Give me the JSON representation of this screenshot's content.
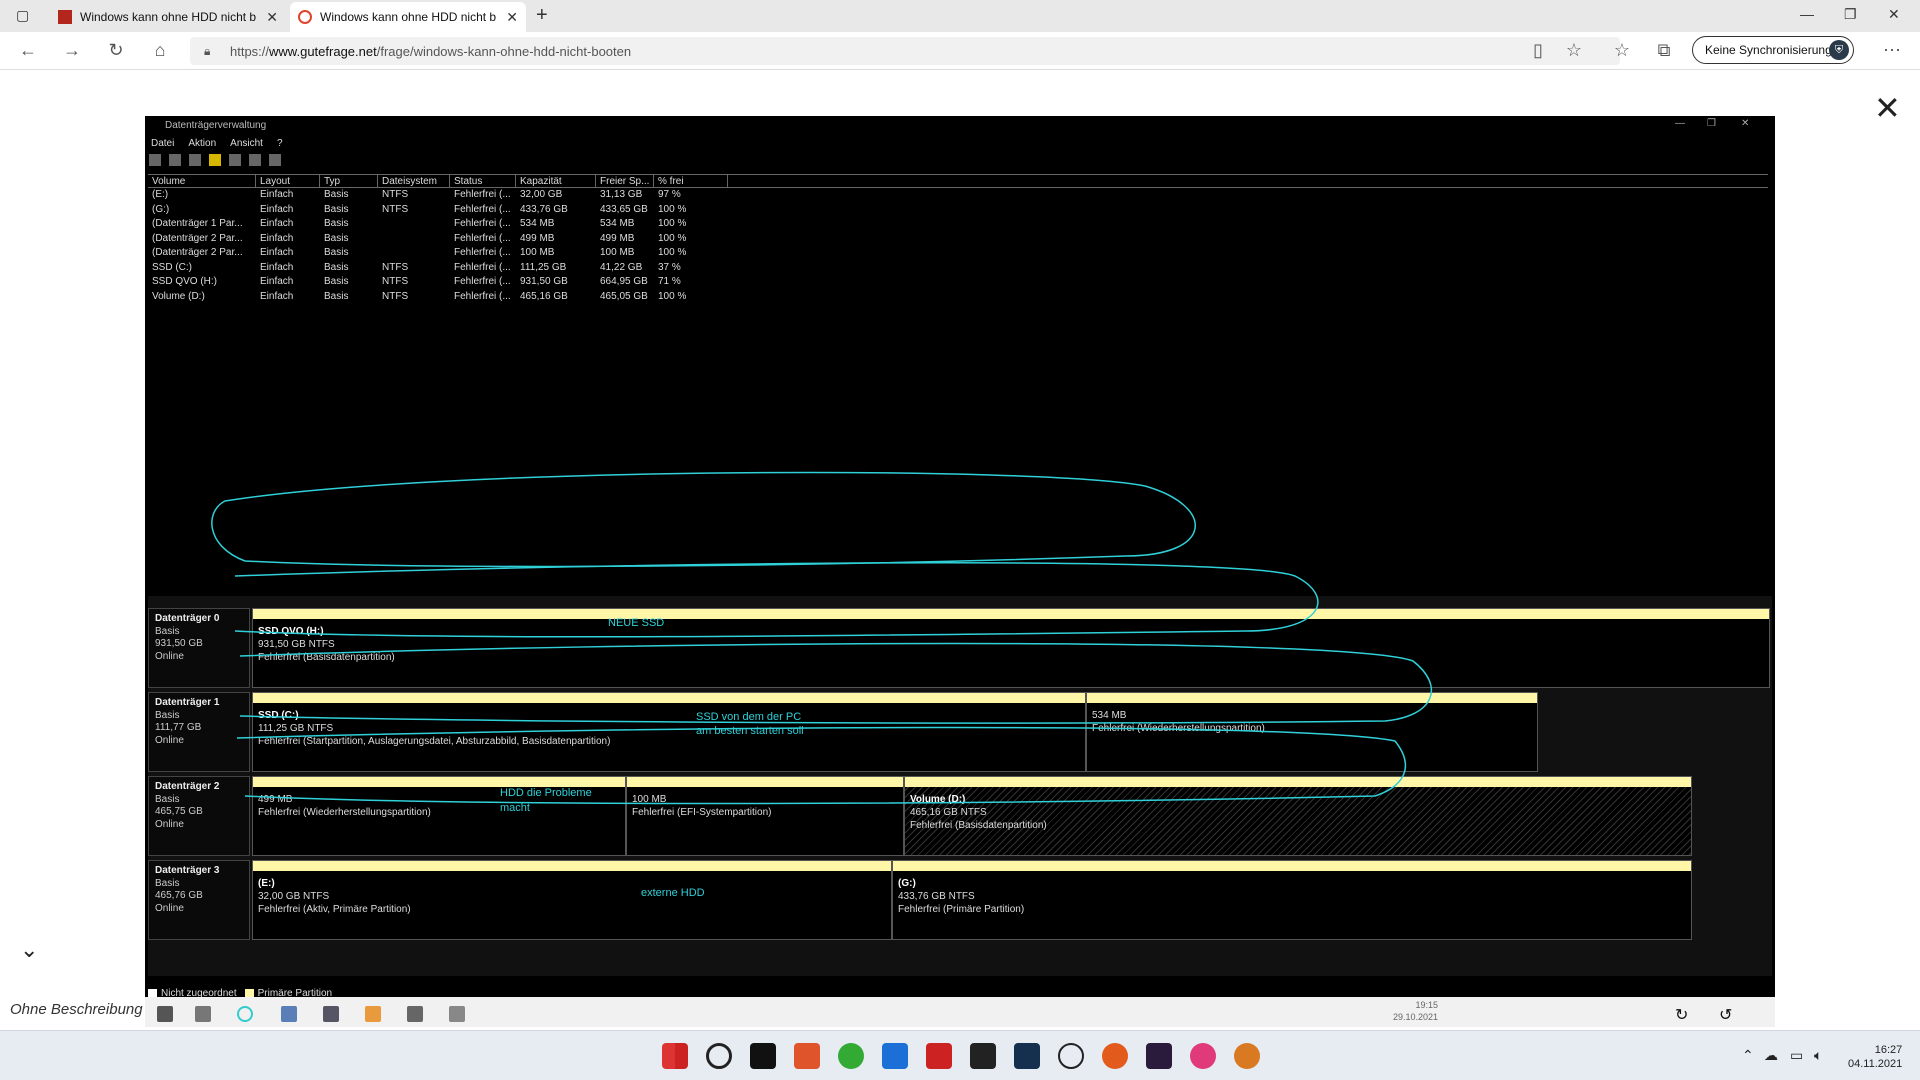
{
  "browser": {
    "tabs": [
      {
        "title": "Windows kann ohne HDD nicht b"
      },
      {
        "title": "Windows kann ohne HDD nicht b"
      }
    ],
    "url_scheme": "https://",
    "url_host": "www.gutefrage.net",
    "url_path": "/frage/windows-kann-ohne-hdd-nicht-booten",
    "sync_label": "Keine Synchronisierung"
  },
  "viewer": {
    "caption": "Ohne Beschreibung"
  },
  "dm": {
    "title": "Datenträgerverwaltung",
    "menu": [
      "Datei",
      "Aktion",
      "Ansicht",
      "?"
    ],
    "columns": [
      "Volume",
      "Layout",
      "Typ",
      "Dateisystem",
      "Status",
      "Kapazität",
      "Freier Sp...",
      "% frei"
    ],
    "volumes": [
      [
        "(E:)",
        "Einfach",
        "Basis",
        "NTFS",
        "Fehlerfrei (...",
        "32,00 GB",
        "31,13 GB",
        "97 %"
      ],
      [
        "(G:)",
        "Einfach",
        "Basis",
        "NTFS",
        "Fehlerfrei (...",
        "433,76 GB",
        "433,65 GB",
        "100 %"
      ],
      [
        "(Datenträger 1 Par...",
        "Einfach",
        "Basis",
        "",
        "Fehlerfrei (...",
        "534 MB",
        "534 MB",
        "100 %"
      ],
      [
        "(Datenträger 2 Par...",
        "Einfach",
        "Basis",
        "",
        "Fehlerfrei (...",
        "499 MB",
        "499 MB",
        "100 %"
      ],
      [
        "(Datenträger 2 Par...",
        "Einfach",
        "Basis",
        "",
        "Fehlerfrei (...",
        "100 MB",
        "100 MB",
        "100 %"
      ],
      [
        "SSD (C:)",
        "Einfach",
        "Basis",
        "NTFS",
        "Fehlerfrei (...",
        "111,25 GB",
        "41,22 GB",
        "37 %"
      ],
      [
        "SSD QVO (H:)",
        "Einfach",
        "Basis",
        "NTFS",
        "Fehlerfrei (...",
        "931,50 GB",
        "664,95 GB",
        "71 %"
      ],
      [
        "Volume (D:)",
        "Einfach",
        "Basis",
        "NTFS",
        "Fehlerfrei (...",
        "465,16 GB",
        "465,05 GB",
        "100 %"
      ]
    ],
    "disks": [
      {
        "name": "Datenträger 0",
        "type": "Basis",
        "size": "931,50 GB",
        "state": "Online",
        "partitions": [
          {
            "name": "SSD QVO  (H:)",
            "size": "931,50 GB NTFS",
            "status": "Fehlerfrei (Basisdatenpartition)"
          }
        ]
      },
      {
        "name": "Datenträger 1",
        "type": "Basis",
        "size": "111,77 GB",
        "state": "Online",
        "partitions": [
          {
            "name": "SSD  (C:)",
            "size": "111,25 GB NTFS",
            "status": "Fehlerfrei (Startpartition, Auslagerungsdatei, Absturzabbild, Basisdatenpartition)"
          },
          {
            "name": "",
            "size": "534 MB",
            "status": "Fehlerfrei (Wiederherstellungspartition)"
          }
        ]
      },
      {
        "name": "Datenträger 2",
        "type": "Basis",
        "size": "465,75 GB",
        "state": "Online",
        "partitions": [
          {
            "name": "",
            "size": "499 MB",
            "status": "Fehlerfrei (Wiederherstellungspartition)"
          },
          {
            "name": "",
            "size": "100 MB",
            "status": "Fehlerfrei (EFI-Systempartition)"
          },
          {
            "name": "Volume  (D:)",
            "size": "465,16 GB NTFS",
            "status": "Fehlerfrei (Basisdatenpartition)"
          }
        ]
      },
      {
        "name": "Datenträger 3",
        "type": "Basis",
        "size": "465,76 GB",
        "state": "Online",
        "partitions": [
          {
            "name": "(E:)",
            "size": "32,00 GB NTFS",
            "status": "Fehlerfrei (Aktiv, Primäre Partition)"
          },
          {
            "name": "(G:)",
            "size": "433,76 GB NTFS",
            "status": "Fehlerfrei (Primäre Partition)"
          }
        ]
      }
    ],
    "annotations": {
      "neue_ssd": "NEUE SSD",
      "ssd_start_1": "SSD von dem der PC",
      "ssd_start_2": "am besten starten soll",
      "hdd_probleme_1": "HDD die Probleme",
      "hdd_probleme_2": "macht",
      "externe_hdd": "externe HDD"
    },
    "legend": {
      "unallocated": "Nicht zugeordnet",
      "primary": "Primäre Partition"
    },
    "shot_clock_time": "19:15",
    "shot_clock_date": "29.10.2021"
  },
  "taskbar": {
    "time": "16:27",
    "date": "04.11.2021"
  },
  "colors": {
    "annotation": "#2fd0d8",
    "partition_bar": "#fff6a8"
  }
}
